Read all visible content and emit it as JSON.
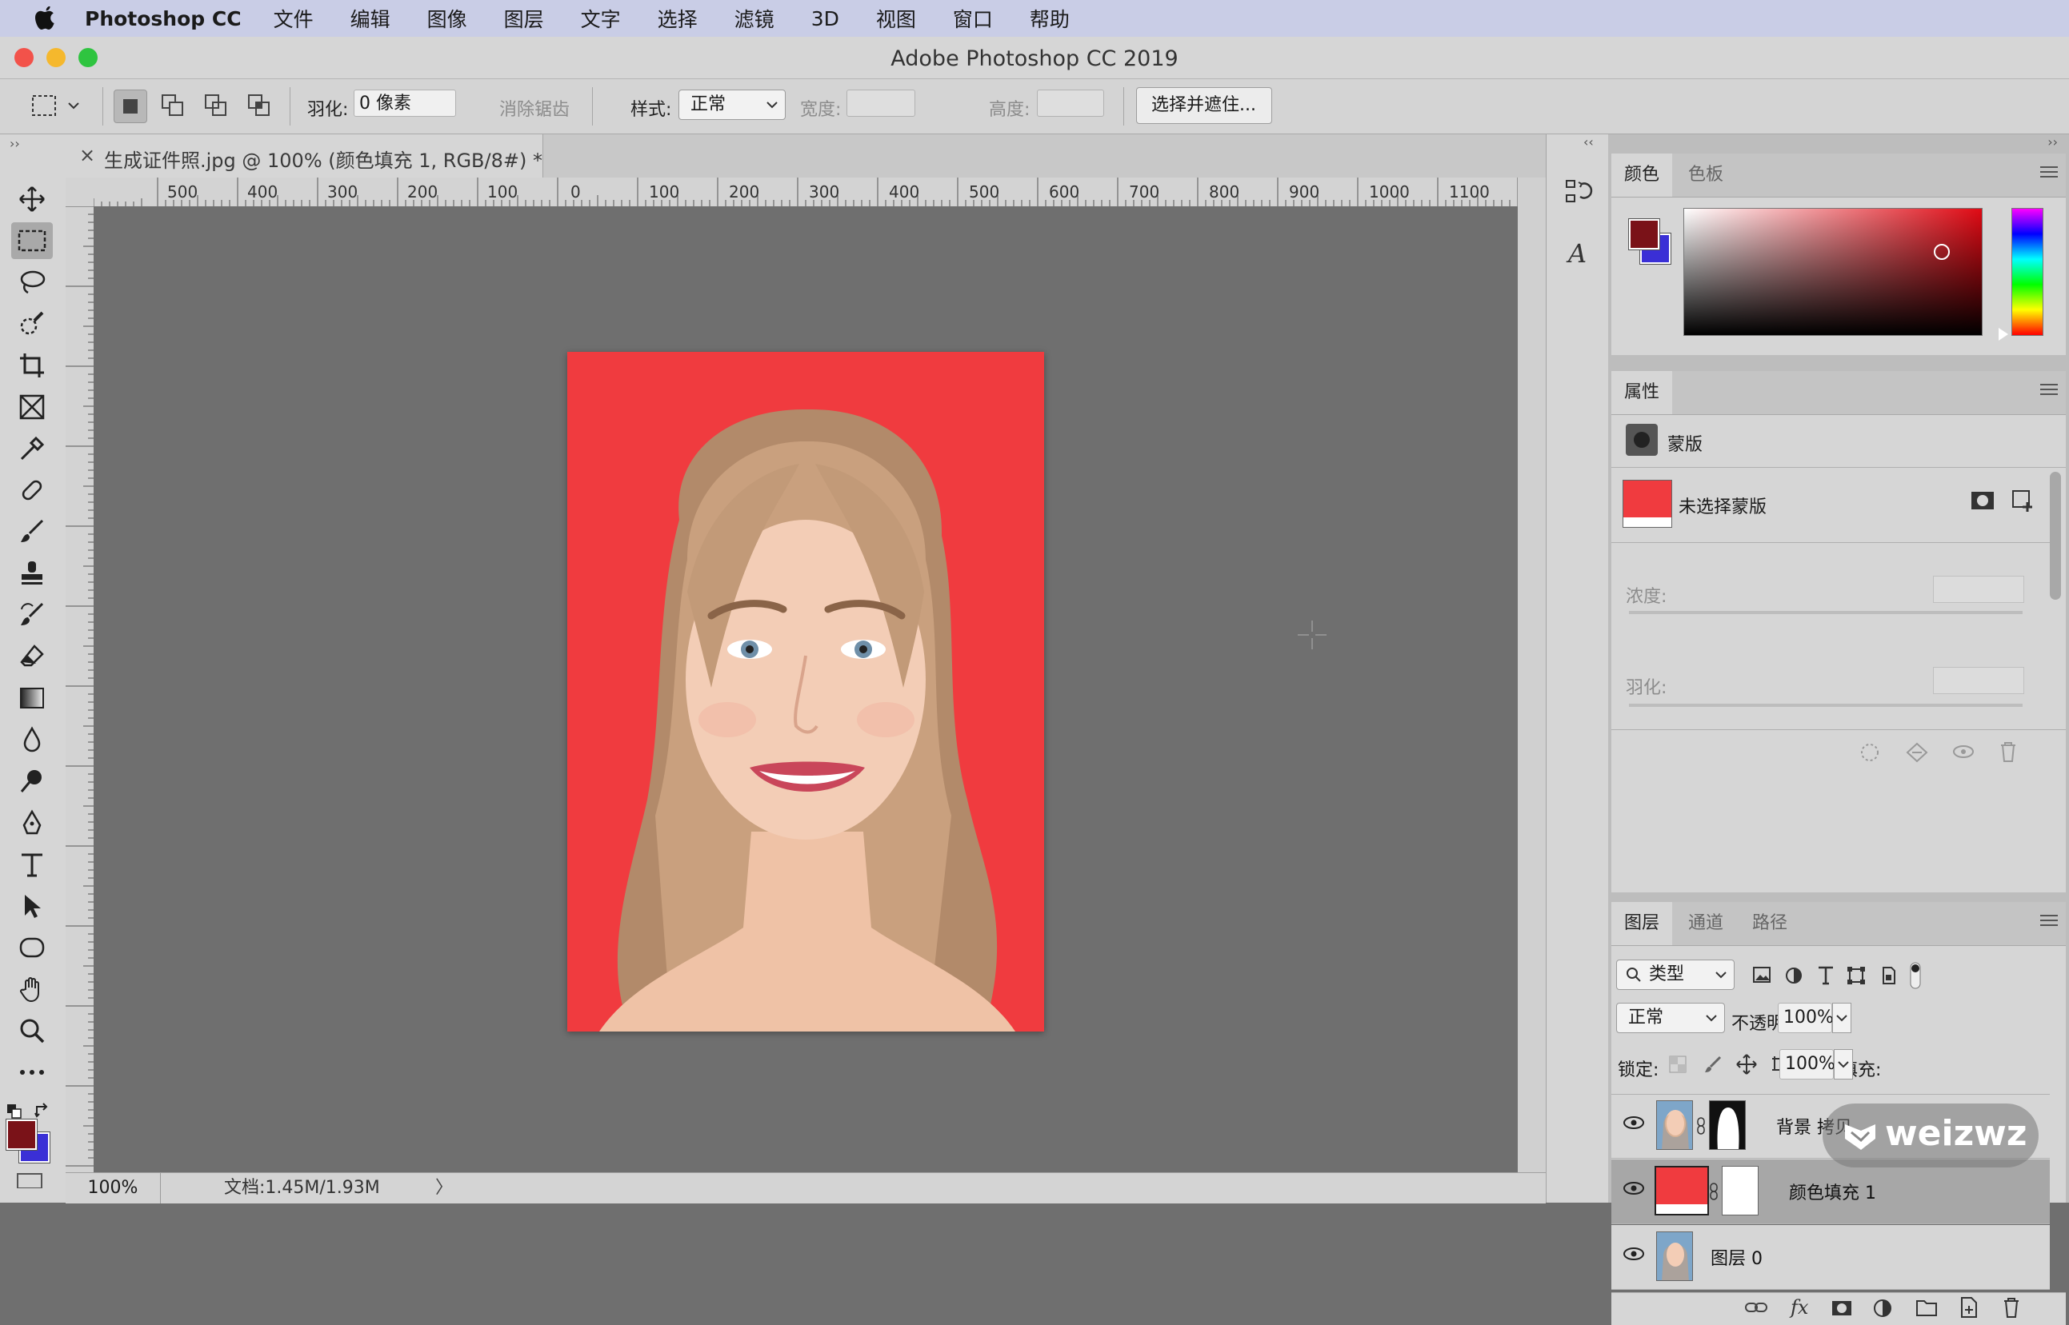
{
  "menubar": {
    "app_name": "Photoshop CC",
    "items": [
      "文件",
      "编辑",
      "图像",
      "图层",
      "文字",
      "选择",
      "滤镜",
      "3D",
      "视图",
      "窗口",
      "帮助"
    ]
  },
  "window": {
    "title": "Adobe Photoshop CC 2019"
  },
  "options_bar": {
    "feather_label": "羽化:",
    "feather_value": "0 像素",
    "antialias_label": "消除锯齿",
    "style_label": "样式:",
    "style_value": "正常",
    "width_label": "宽度:",
    "height_label": "高度:",
    "select_mask_button": "选择并遮住..."
  },
  "document": {
    "tab_close": "×",
    "tab_title": "生成证件照.jpg @ 100% (颜色填充 1, RGB/8#) *",
    "ruler_top": [
      "500",
      "400",
      "300",
      "200",
      "100",
      "0",
      "100",
      "200",
      "300",
      "400",
      "500",
      "600",
      "700",
      "800",
      "900",
      "1000",
      "1100"
    ],
    "ruler_left": [
      "0",
      "0",
      "1\n0\n0",
      "0",
      "1\n0\n0",
      "2\n0\n0",
      "3\n0\n0",
      "4\n0\n0",
      "5\n0\n0",
      "6\n0\n0",
      "7\n0\n0",
      "8\n0\n0",
      "9\n0\n0",
      "1\n0"
    ],
    "photo_background_color": "#f03b3f"
  },
  "status_bar": {
    "zoom": "100%",
    "doc_info": "文档:1.45M/1.93M",
    "arrow": "〉"
  },
  "panels": {
    "color": {
      "tabs": [
        "颜色",
        "色板"
      ],
      "foreground": "#7a1218",
      "background": "#3a2fd6"
    },
    "properties": {
      "tab": "属性",
      "header": "蒙版",
      "no_mask": "未选择蒙版",
      "density_label": "浓度:",
      "feather_label": "羽化:"
    },
    "layers": {
      "tabs": [
        "图层",
        "通道",
        "路径"
      ],
      "filter_label": "类型",
      "blend_mode": "正常",
      "opacity_label": "不透明度:",
      "opacity_value": "100%",
      "lock_label": "锁定:",
      "fill_label": "填充:",
      "fill_value": "100%",
      "items": [
        {
          "name": "背景 拷贝",
          "selected": false
        },
        {
          "name": "颜色填充 1",
          "selected": true
        },
        {
          "name": "图层 0",
          "selected": false
        }
      ],
      "fx_label": "fx"
    }
  },
  "watermark": {
    "text": "weizwz"
  }
}
